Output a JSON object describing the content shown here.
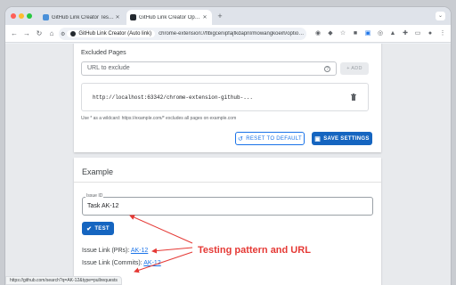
{
  "tabs": [
    {
      "title": "GitHub Link Creator Test Page",
      "active": false
    },
    {
      "title": "GitHub Link Creator Options",
      "active": true
    }
  ],
  "toolbar": {
    "chip_label": "GitHub Link Creator (Auto link)",
    "url": "chrome-extension://flbigcenipfajfkdapnl/mowangkoeih/options.html"
  },
  "excluded": {
    "heading": "Excluded Pages",
    "input_placeholder": "URL to exclude",
    "add_label": "+ ADD",
    "entry": "http://localhost:63342/chrome-extension-github-...",
    "hint": "Use * as a wildcard: https://example.com/* excludes all pages on example.com",
    "reset_label": "RESET TO DEFAULT",
    "save_label": "SAVE SETTINGS"
  },
  "example": {
    "title": "Example",
    "field_label": "Issue ID",
    "field_value": "Task AK-12",
    "test_label": "TEST",
    "prs_prefix": "Issue Link (PRs):",
    "prs_link": "AK-12",
    "commits_prefix": "Issue Link (Commits):",
    "commits_link": "AK-12"
  },
  "annotation": {
    "text": "Testing pattern and URL",
    "color": "#e53935"
  },
  "status_url": "https://github.com/search?q=AK-12&type=pullrequests",
  "colors": {
    "primary": "#1565c0",
    "link": "#1a73e8"
  },
  "icons": [
    "tune-icon",
    "refresh-icon",
    "check-circle-icon",
    "delete-icon",
    "help-icon",
    "restore-icon",
    "save-icon"
  ]
}
